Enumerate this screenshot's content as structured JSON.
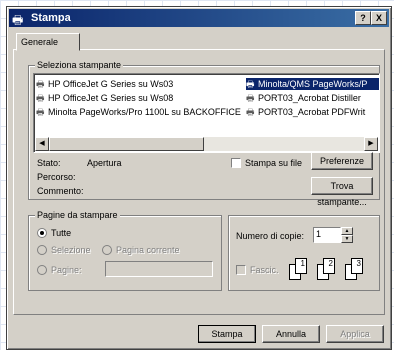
{
  "window": {
    "title": "Stampa",
    "help_button": "?",
    "close_button": "X"
  },
  "tabs": [
    {
      "label": "Generale"
    }
  ],
  "printer_group": {
    "label": "Seleziona stampante",
    "printers": [
      {
        "name": "HP OfficeJet G Series su Ws03"
      },
      {
        "name": "HP OfficeJet G Series su Ws08"
      },
      {
        "name": "Minolta PageWorks/Pro 1100L su BACKOFFICE"
      },
      {
        "name": "Minolta/QMS PageWorks/P",
        "selected": true
      },
      {
        "name": "PORT03_Acrobat Distiller"
      },
      {
        "name": "PORT03_Acrobat PDFWrit"
      }
    ],
    "status_label": "Stato:",
    "status_value": "Apertura",
    "location_label": "Percorso:",
    "comment_label": "Commento:",
    "print_to_file": "Stampa su file",
    "preferences_button": "Preferenze",
    "find_printer_button": "Trova stampante..."
  },
  "pages_group": {
    "label": "Pagine da stampare",
    "all": "Tutte",
    "selection": "Selezione",
    "current_page": "Pagina corrente",
    "pages": "Pagine:"
  },
  "copies_group": {
    "copies_label": "Numero di copie:",
    "copies_value": "1",
    "collate": "Fascic.",
    "page_numbers": [
      "1",
      "1",
      "2",
      "2",
      "3",
      "3"
    ]
  },
  "buttons": {
    "print": "Stampa",
    "cancel": "Annulla",
    "apply": "Applica"
  }
}
